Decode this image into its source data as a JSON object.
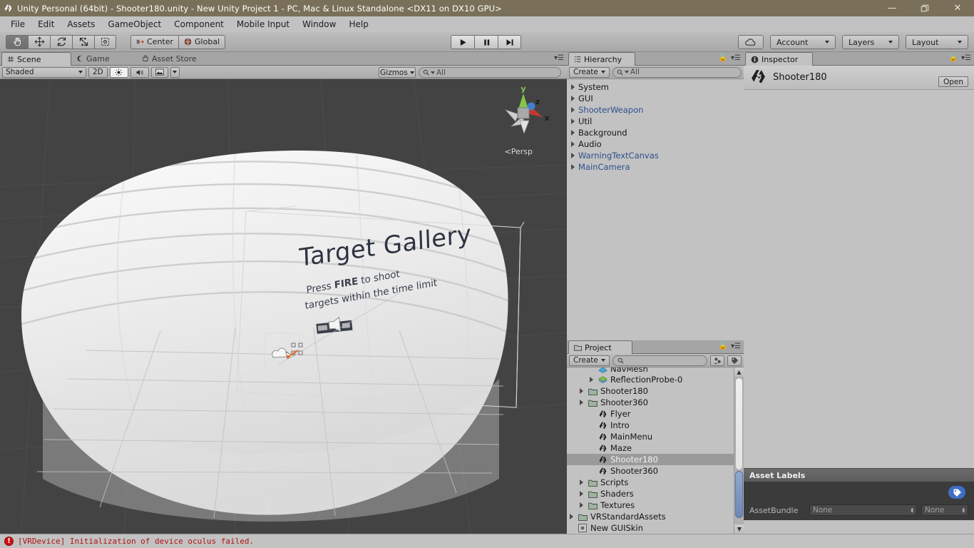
{
  "window": {
    "title": "Unity Personal (64bit) - Shooter180.unity - New Unity Project 1 - PC, Mac & Linux Standalone <DX11 on DX10 GPU>",
    "app_icon": "unity-icon",
    "controls": {
      "minimize": "—",
      "maximize": "❐",
      "close": "✕"
    }
  },
  "menubar": {
    "items": [
      "File",
      "Edit",
      "Assets",
      "GameObject",
      "Component",
      "Mobile Input",
      "Window",
      "Help"
    ]
  },
  "toolbar": {
    "transform_tools": [
      {
        "name": "hand-tool",
        "glyph": "✋",
        "active": true
      },
      {
        "name": "move-tool",
        "glyph": "✥",
        "active": false
      },
      {
        "name": "rotate-tool",
        "glyph": "↻",
        "active": false
      },
      {
        "name": "scale-tool",
        "glyph": "⤢",
        "active": false
      },
      {
        "name": "rect-tool",
        "glyph": "▣",
        "active": false
      }
    ],
    "pivot_label": "Center",
    "pivot_rotation_label": "Global",
    "play_label": "▶",
    "pause_label": "❙❙",
    "step_label": "▶❘",
    "cloud_label": "☁",
    "account_label": "Account",
    "layers_label": "Layers",
    "layout_label": "Layout"
  },
  "scene": {
    "tabs": [
      {
        "label": "Scene",
        "icon": "grid-icon",
        "active": true
      },
      {
        "label": "Game",
        "icon": "gamepad-icon",
        "active": false
      },
      {
        "label": "Asset Store",
        "icon": "cart-icon",
        "active": false
      }
    ],
    "draw_mode": "Shaded",
    "two_d_label": "2D",
    "lighting_icon": "sun-icon",
    "audio_icon": "speaker-icon",
    "effects_icon": "image-icon",
    "gizmos_label": "Gizmos",
    "search_placeholder": "All",
    "search_value": "",
    "perspective_label": "Persp",
    "axis_labels": {
      "x": "x",
      "y": "y",
      "z": "z"
    },
    "content": {
      "headline": "Target Gallery",
      "sub_line1": "Press FIRE to shoot",
      "sub_line2": "targets within the time limit",
      "sub_bold": "FIRE"
    }
  },
  "hierarchy": {
    "tab_label": "Hierarchy",
    "tab_icon": "hierarchy-icon",
    "create_label": "Create",
    "search_placeholder": "All",
    "search_value": "",
    "items": [
      {
        "label": "System",
        "prefab": false
      },
      {
        "label": "GUI",
        "prefab": false
      },
      {
        "label": "ShooterWeapon",
        "prefab": true
      },
      {
        "label": "Util",
        "prefab": false
      },
      {
        "label": "Background",
        "prefab": false
      },
      {
        "label": "Audio",
        "prefab": false
      },
      {
        "label": "WarningTextCanvas",
        "prefab": true
      },
      {
        "label": "MainCamera",
        "prefab": true
      }
    ]
  },
  "project": {
    "tab_label": "Project",
    "tab_icon": "folder-icon",
    "create_label": "Create",
    "search_placeholder": "",
    "search_value": "",
    "items": [
      {
        "label": "NavMesh",
        "icon": "navmesh-icon",
        "indent": 2,
        "arrow": false,
        "selected": false,
        "clipped": true
      },
      {
        "label": "ReflectionProbe-0",
        "icon": "probe-icon",
        "indent": 2,
        "arrow": true,
        "selected": false
      },
      {
        "label": "Shooter180",
        "icon": "folder-icon",
        "indent": 1,
        "arrow": true,
        "selected": false
      },
      {
        "label": "Shooter360",
        "icon": "folder-icon",
        "indent": 1,
        "arrow": true,
        "selected": false
      },
      {
        "label": "Flyer",
        "icon": "scene-icon",
        "indent": 2,
        "arrow": false,
        "selected": false
      },
      {
        "label": "Intro",
        "icon": "scene-icon",
        "indent": 2,
        "arrow": false,
        "selected": false
      },
      {
        "label": "MainMenu",
        "icon": "scene-icon",
        "indent": 2,
        "arrow": false,
        "selected": false
      },
      {
        "label": "Maze",
        "icon": "scene-icon",
        "indent": 2,
        "arrow": false,
        "selected": false
      },
      {
        "label": "Shooter180",
        "icon": "scene-icon",
        "indent": 2,
        "arrow": false,
        "selected": true
      },
      {
        "label": "Shooter360",
        "icon": "scene-icon",
        "indent": 2,
        "arrow": false,
        "selected": false
      },
      {
        "label": "Scripts",
        "icon": "folder-icon",
        "indent": 1,
        "arrow": true,
        "selected": false
      },
      {
        "label": "Shaders",
        "icon": "folder-icon",
        "indent": 1,
        "arrow": true,
        "selected": false
      },
      {
        "label": "Textures",
        "icon": "folder-icon",
        "indent": 1,
        "arrow": true,
        "selected": false
      },
      {
        "label": "VRStandardAssets",
        "icon": "folder-icon",
        "indent": 0,
        "arrow": true,
        "selected": false
      },
      {
        "label": "New GUISkin",
        "icon": "guiskin-icon",
        "indent": 0,
        "arrow": false,
        "selected": false
      }
    ]
  },
  "inspector": {
    "tab_label": "Inspector",
    "tab_icon": "info-icon",
    "asset_name": "Shooter180",
    "asset_icon": "unity-scene-icon",
    "open_label": "Open",
    "asset_labels_header": "Asset Labels",
    "tag_icon": "label-icon",
    "assetbundle_label": "AssetBundle",
    "assetbundle_value": "None",
    "assetbundle_variant": "None"
  },
  "statusbar": {
    "icon": "error-icon",
    "message": "[VRDevice] Initialization of device oculus failed."
  },
  "colors": {
    "titlebar": "#7a7059",
    "chrome": "#c2c2c2",
    "scene_bg": "#434343",
    "prefab_blue": "#2d4f8e",
    "error_red": "#b11212",
    "selection": "#9a9a9a",
    "dark_panel": "#3b3b3b",
    "accent_blue": "#3f6fc4"
  }
}
